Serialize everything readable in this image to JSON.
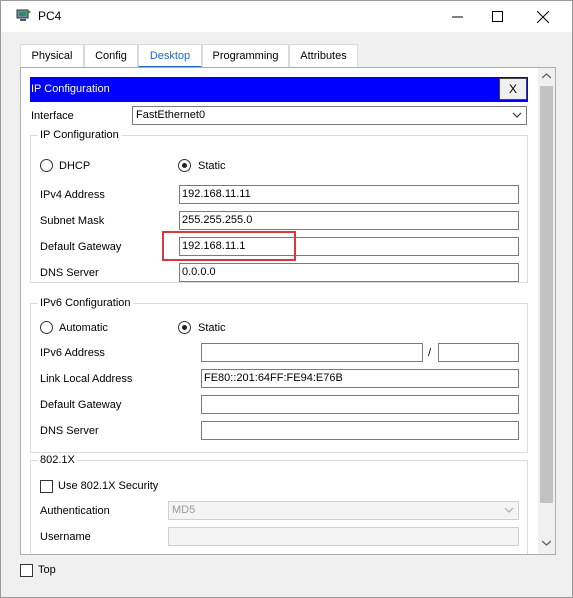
{
  "window": {
    "title": "PC4",
    "icon": "pc-icon"
  },
  "tabs": [
    {
      "label": "Physical"
    },
    {
      "label": "Config"
    },
    {
      "label": "Desktop",
      "active": true
    },
    {
      "label": "Programming"
    },
    {
      "label": "Attributes"
    }
  ],
  "ip_config": {
    "header_title": "IP Configuration",
    "close_label": "X",
    "interface_label": "Interface",
    "interface_value": "FastEthernet0",
    "ipv4_group_title": "IP Configuration",
    "dhcp_label": "DHCP",
    "static_label": "Static",
    "mode": "Static",
    "ipv4_address_label": "IPv4 Address",
    "ipv4_address": "192.168.11.11",
    "subnet_mask_label": "Subnet Mask",
    "subnet_mask": "255.255.255.0",
    "gateway_label": "Default Gateway",
    "gateway": "192.168.11.1",
    "dns_label": "DNS Server",
    "dns": "0.0.0.0"
  },
  "ipv6_config": {
    "group_title": "IPv6 Configuration",
    "automatic_label": "Automatic",
    "static_label": "Static",
    "mode": "Static",
    "address_label": "IPv6 Address",
    "address": "",
    "prefix_sep": "/",
    "prefix": "",
    "link_local_label": "Link Local Address",
    "link_local": "FE80::201:64FF:FE94:E76B",
    "gateway_label": "Default Gateway",
    "gateway": "",
    "dns_label": "DNS Server",
    "dns": ""
  },
  "dot1x": {
    "group_title": "802.1X",
    "use_security_label": "Use 802.1X Security",
    "use_security": false,
    "auth_label": "Authentication",
    "auth_value": "MD5",
    "username_label": "Username",
    "username": ""
  },
  "footer": {
    "top_label": "Top"
  },
  "colors": {
    "header_blue": "#0000ff",
    "active_tab": "#1a6bbf",
    "highlight_red": "#d9393e"
  }
}
